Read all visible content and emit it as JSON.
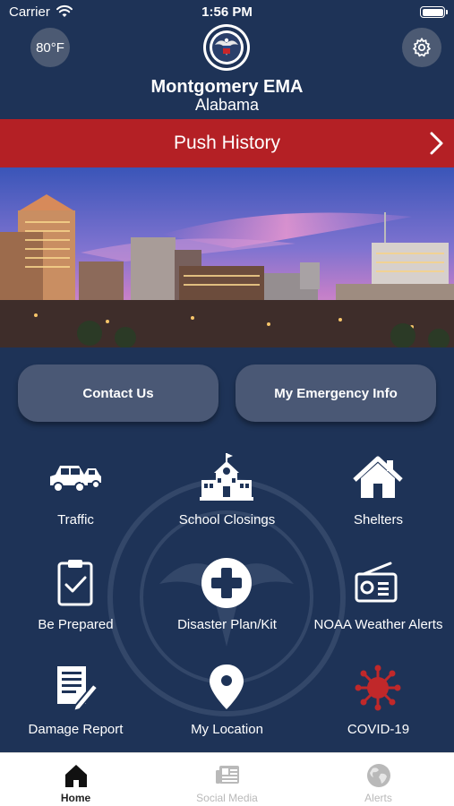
{
  "status_bar": {
    "carrier": "Carrier",
    "time": "1:56 PM"
  },
  "header": {
    "temperature": "80°F",
    "title": "Montgomery EMA",
    "subtitle": "Alabama",
    "seal_text": "MONTGOMERY CITY / COUNTY EMERGENCY MANAGEMENT AGENCY"
  },
  "push_history": {
    "label": "Push History"
  },
  "buttons": {
    "contact_us": "Contact Us",
    "my_emergency_info": "My Emergency Info"
  },
  "grid": [
    {
      "label": "Traffic",
      "icon": "cars-icon"
    },
    {
      "label": "School Closings",
      "icon": "school-icon"
    },
    {
      "label": "Shelters",
      "icon": "house-icon"
    },
    {
      "label": "Be Prepared",
      "icon": "clipboard-check-icon"
    },
    {
      "label": "Disaster Plan/Kit",
      "icon": "medical-cross-icon"
    },
    {
      "label": "NOAA Weather Alerts",
      "icon": "radio-icon"
    },
    {
      "label": "Damage Report",
      "icon": "report-pencil-icon"
    },
    {
      "label": "My Location",
      "icon": "location-pin-icon"
    },
    {
      "label": "COVID-19",
      "icon": "virus-icon"
    }
  ],
  "tabs": [
    {
      "label": "Home",
      "icon": "home-icon",
      "active": true
    },
    {
      "label": "Social Media",
      "icon": "newspaper-icon",
      "active": false
    },
    {
      "label": "Alerts",
      "icon": "globe-icon",
      "active": false
    }
  ],
  "colors": {
    "background": "#1e3357",
    "accent_red": "#b42025",
    "button_gray": "#4a5875",
    "covid_red": "#c0282a"
  }
}
